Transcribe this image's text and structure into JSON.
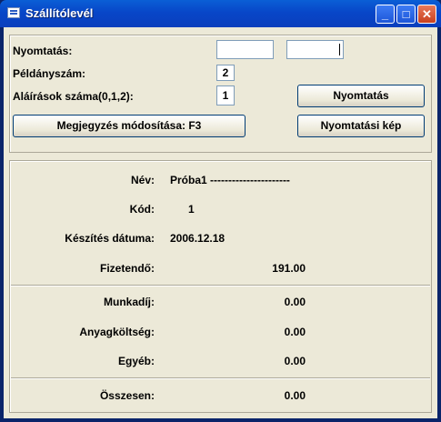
{
  "window": {
    "title": "Szállítólevél",
    "min_symbol": "_",
    "max_symbol": "□",
    "close_symbol": "✕"
  },
  "form": {
    "print_label": "Nyomtatás:",
    "copies_label": "Példányszám:",
    "copies_value": "2",
    "signatures_label": "Aláírások száma(0,1,2):",
    "signatures_value": "1",
    "edit_note_button": "Megjegyzés módosítása: F3",
    "print_button": "Nyomtatás",
    "print_preview_button": "Nyomtatási kép"
  },
  "details": {
    "name_label": "Név:",
    "name_value": "Próba1 ----------------------",
    "code_label": "Kód:",
    "code_value": "1",
    "created_label": "Készítés dátuma:",
    "created_value": "2006.12.18",
    "payable_label": "Fizetendő:",
    "payable_value": "191.00",
    "labor_label": "Munkadíj:",
    "labor_value": "0.00",
    "material_label": "Anyagköltség:",
    "material_value": "0.00",
    "other_label": "Egyéb:",
    "other_value": "0.00",
    "total_label": "Összesen:",
    "total_value": "0.00"
  }
}
